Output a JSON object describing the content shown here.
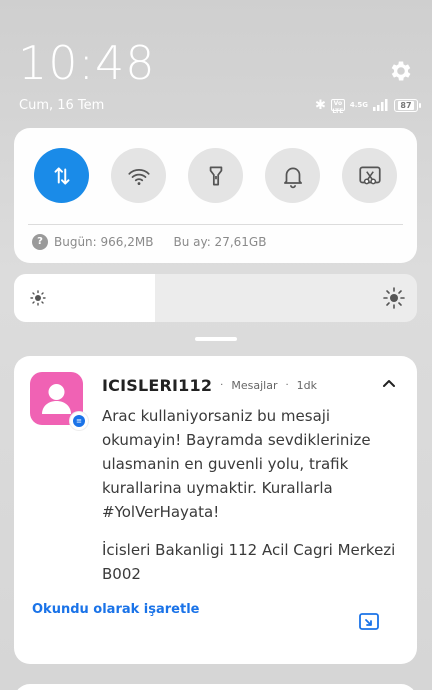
{
  "status": {
    "time": "10:48",
    "date": "Cum, 16 Tem",
    "volte": "Vo LTE",
    "network": "4.5G",
    "battery": "87",
    "icons": [
      "bluetooth-icon",
      "volte-icon",
      "signal-icon",
      "battery-icon"
    ]
  },
  "quick_settings": {
    "toggles": [
      {
        "name": "mobile-data",
        "icon": "data-transfer-icon",
        "on": true
      },
      {
        "name": "wifi",
        "icon": "wifi-icon",
        "on": false
      },
      {
        "name": "flashlight",
        "icon": "flashlight-icon",
        "on": false
      },
      {
        "name": "sound",
        "icon": "bell-icon",
        "on": false
      },
      {
        "name": "screenshot",
        "icon": "screenshot-icon",
        "on": false
      }
    ],
    "data_today": "Bugün: 966,2MB",
    "data_month": "Bu ay: 27,61GB"
  },
  "brightness": {
    "level": 0.35
  },
  "notification": {
    "sender": "ICISLERI112",
    "app": "Mesajlar",
    "age": "1dk",
    "body_1": "Arac kullaniyorsaniz bu mesaji okumayin! Bayramda sevdiklerinize ulasmanin en guvenli yolu, trafik kurallarina uymaktir. Kurallarla #YolVerHayata!",
    "body_2": "İcisleri Bakanligi 112 Acil Cagri Merkezi B002",
    "action_label": "Okundu olarak işaretle",
    "separator": "·"
  },
  "colors": {
    "accent": "#1a8be8",
    "app_icon": "#f062b4",
    "action": "#1a73e8"
  }
}
